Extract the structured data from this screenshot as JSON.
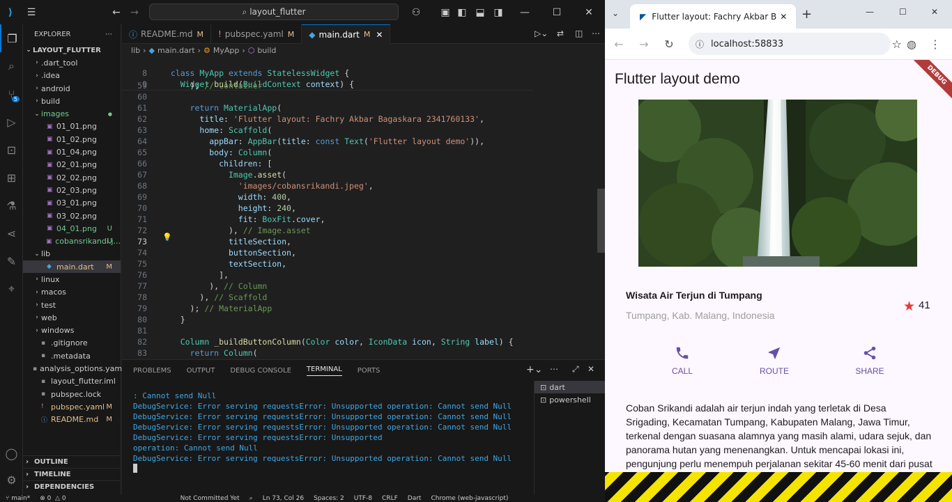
{
  "vscode": {
    "search_text": "layout_flutter",
    "explorer_title": "EXPLORER",
    "project": "LAYOUT_FLUTTER",
    "tree": [
      {
        "label": ".dart_tool",
        "type": "folder",
        "status": ""
      },
      {
        "label": ".idea",
        "type": "folder",
        "status": ""
      },
      {
        "label": "android",
        "type": "folder",
        "status": ""
      },
      {
        "label": "build",
        "type": "folder",
        "status": ""
      },
      {
        "label": "images",
        "type": "folder-open",
        "status": "dot"
      },
      {
        "label": "01_01.png",
        "type": "image",
        "status": ""
      },
      {
        "label": "01_02.png",
        "type": "image",
        "status": ""
      },
      {
        "label": "01_04.png",
        "type": "image",
        "status": ""
      },
      {
        "label": "02_01.png",
        "type": "image",
        "status": ""
      },
      {
        "label": "02_02.png",
        "type": "image",
        "status": ""
      },
      {
        "label": "02_03.png",
        "type": "image",
        "status": ""
      },
      {
        "label": "03_01.png",
        "type": "image",
        "status": ""
      },
      {
        "label": "03_02.png",
        "type": "image",
        "status": ""
      },
      {
        "label": "04_01.png",
        "type": "image",
        "status": "U"
      },
      {
        "label": "cobansrikandi.j...",
        "type": "image",
        "status": "U"
      },
      {
        "label": "lib",
        "type": "folder-open",
        "status": ""
      },
      {
        "label": "main.dart",
        "type": "dart",
        "status": "M"
      },
      {
        "label": "linux",
        "type": "folder",
        "status": ""
      },
      {
        "label": "macos",
        "type": "folder",
        "status": ""
      },
      {
        "label": "test",
        "type": "folder",
        "status": ""
      },
      {
        "label": "web",
        "type": "folder",
        "status": ""
      },
      {
        "label": "windows",
        "type": "folder",
        "status": ""
      },
      {
        "label": ".gitignore",
        "type": "file",
        "status": ""
      },
      {
        "label": ".metadata",
        "type": "file",
        "status": ""
      },
      {
        "label": "analysis_options.yaml",
        "type": "file",
        "status": ""
      },
      {
        "label": "layout_flutter.iml",
        "type": "file",
        "status": ""
      },
      {
        "label": "pubspec.lock",
        "type": "file",
        "status": ""
      },
      {
        "label": "pubspec.yaml",
        "type": "yaml",
        "status": "M"
      },
      {
        "label": "README.md",
        "type": "info",
        "status": "M"
      }
    ],
    "outline": "OUTLINE",
    "timeline": "TIMELINE",
    "dependencies": "DEPENDENCIES",
    "tabs": [
      {
        "label": "README.md",
        "mod": "M"
      },
      {
        "label": "pubspec.yaml",
        "mod": "M"
      },
      {
        "label": "main.dart",
        "mod": "M"
      }
    ],
    "breadcrumb": [
      "lib",
      "main.dart",
      "MyApp",
      "build"
    ],
    "panel_tabs": [
      "PROBLEMS",
      "OUTPUT",
      "DEBUG CONSOLE",
      "TERMINAL",
      "PORTS"
    ],
    "terminal_lines": [
      ": Cannot send Null",
      "DebugService: Error serving requestsError: Unsupported operation: Cannot send Null",
      "DebugService: Error serving requestsError: Unsupported operation: Cannot send Null",
      "DebugService: Error serving requestsError: Unsupported operation: Cannot send Null",
      "DebugService: Error serving requestsError: Unsupported",
      "operation: Cannot send Null",
      "DebugService: Error serving requestsError: Unsupported operation: Cannot send Null"
    ],
    "terminals": [
      "dart",
      "powershell"
    ],
    "status": {
      "branch": "main*",
      "problems": "0  △ 0",
      "commit": "Not Committed Yet",
      "position": "Ln 73, Col 26",
      "spaces": "Spaces: 2",
      "encoding": "UTF-8",
      "eol": "CRLF",
      "language": "Dart",
      "device": "Chrome (web-javascript)"
    }
  },
  "chrome": {
    "tab_title": "Flutter layout: Fachry Akbar Ba...",
    "url": "localhost:58833",
    "app": {
      "appbar_title": "Flutter layout demo",
      "debug_banner": "DEBUG",
      "place_name": "Wisata Air Terjun di Tumpang",
      "place_location": "Tumpang, Kab. Malang, Indonesia",
      "likes": "41",
      "buttons": [
        "CALL",
        "ROUTE",
        "SHARE"
      ],
      "description": "Coban Srikandi adalah air terjun indah yang terletak di Desa Srigading, Kecamatan Tumpang, Kabupaten Malang, Jawa Timur, terkenal dengan suasana alamnya yang masih alami, udara sejuk, dan panorama hutan yang menenangkan. Untuk mencapai lokasi ini, pengunjung perlu menempuh perjalanan sekitar 45-60 menit dari pusat kota Malang. Di sekitar air terjun terdapat jalur trekking yang menantang dan pemandangan hijau yang asri."
    }
  },
  "colors": {
    "accent": "#0078d4",
    "flutter_primary": "#6750a4",
    "star": "#e53935"
  }
}
